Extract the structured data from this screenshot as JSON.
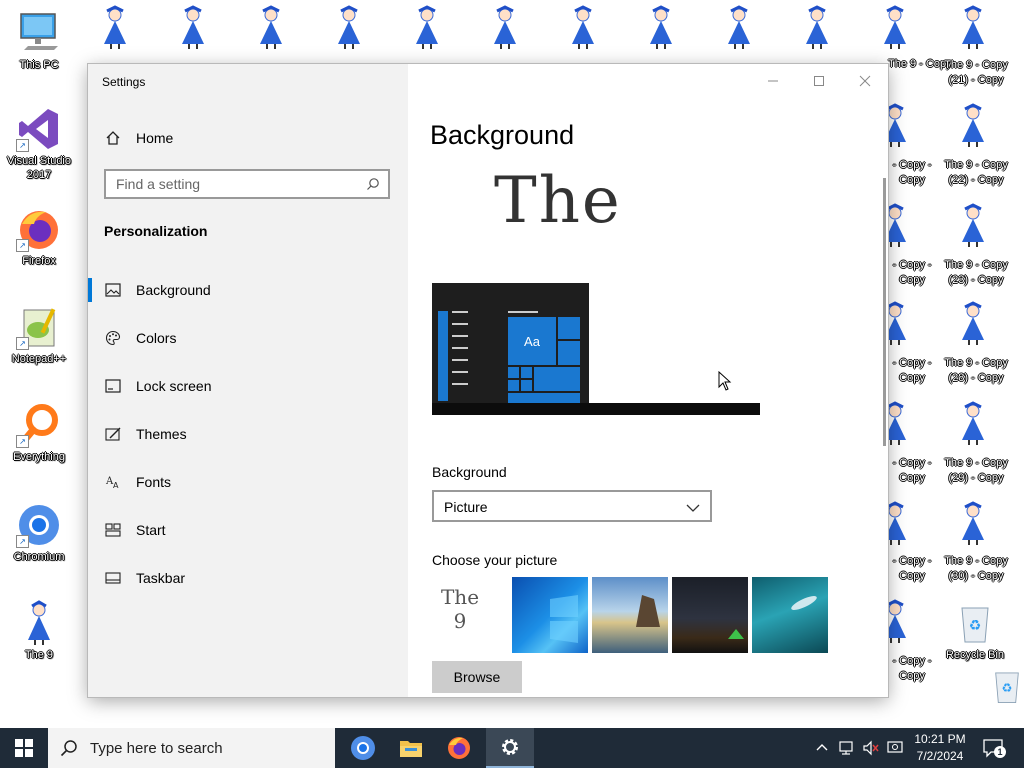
{
  "desktop": {
    "icons": [
      {
        "label": "This PC"
      },
      {
        "label": "Visual Studio 2017"
      },
      {
        "label": "Firefox"
      },
      {
        "label": "Notepad++"
      },
      {
        "label": "Everything"
      },
      {
        "label": "Chromium"
      },
      {
        "label": "The 9"
      },
      {
        "label": "Recycle Bin"
      }
    ],
    "right_labels": [
      "The 9 - Copy (21) - Copy",
      "The 9 - Copy (22) - Copy",
      "The 9 - Copy (23) - Copy",
      "The 9 - Copy (28) - Copy",
      "The 9 - Copy (29) - Copy",
      "The 9 - Copy (30) - Copy"
    ],
    "col_labels": [
      "- Copy - Copy",
      "- Copy - Copy",
      "- Copy - Copy",
      "- Copy - Copy",
      "- Copy - Copy",
      "- Copy - Copy",
      "- Copy - Copy"
    ],
    "top_col_label": "The 9 - Copy"
  },
  "settings": {
    "app_title": "Settings",
    "home_label": "Home",
    "search_placeholder": "Find a setting",
    "section_title": "Personalization",
    "nav": [
      {
        "label": "Background",
        "icon": "picture-icon"
      },
      {
        "label": "Colors",
        "icon": "palette-icon"
      },
      {
        "label": "Lock screen",
        "icon": "lock-screen-icon"
      },
      {
        "label": "Themes",
        "icon": "themes-icon"
      },
      {
        "label": "Fonts",
        "icon": "fonts-icon"
      },
      {
        "label": "Start",
        "icon": "start-icon"
      },
      {
        "label": "Taskbar",
        "icon": "taskbar-icon"
      }
    ],
    "page_title": "Background",
    "preview_text": "The",
    "preview_tile_text": "Aa",
    "background_label": "Background",
    "background_value": "Picture",
    "choose_label": "Choose your picture",
    "thumb_first_text": "The 9",
    "browse_label": "Browse"
  },
  "taskbar": {
    "search_placeholder": "Type here to search",
    "time": "10:21 PM",
    "date": "7/2/2024",
    "notification_count": "1"
  },
  "colors": {
    "accent": "#0078d7",
    "taskbar": "#1f2b38"
  }
}
